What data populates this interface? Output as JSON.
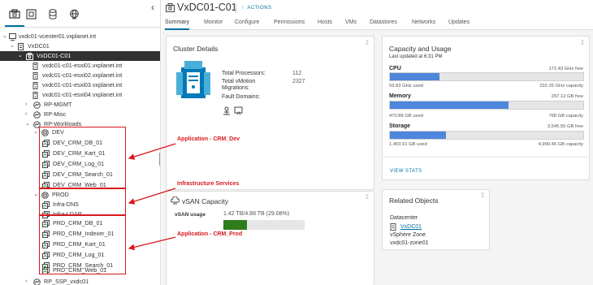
{
  "tree": {
    "collapse_glyph": "‹",
    "rows": [
      {
        "label": "vxdc01-vcenter01.vxplanet.int",
        "icon": "vcenter-icon",
        "caret": "⌄"
      },
      {
        "label": "VxDC01",
        "icon": "datacenter-icon",
        "caret": "⌄"
      },
      {
        "label": "VxDC01-C01",
        "icon": "cluster-icon",
        "caret": "⌄",
        "selected": true
      },
      {
        "label": "vxdc01-c01-esxi01.vxplanet.int",
        "icon": "host-icon"
      },
      {
        "label": "vxdc01-c01-esxi02.vxplanet.int",
        "icon": "host-icon"
      },
      {
        "label": "vxdc01-c01-esxi03.vxplanet.int",
        "icon": "host-icon"
      },
      {
        "label": "vxdc01-c01-esxi04.vxplanet.int",
        "icon": "host-icon"
      },
      {
        "label": "RP-MGMT",
        "icon": "resource-pool-icon",
        "caret": "›"
      },
      {
        "label": "RP-Misc",
        "icon": "resource-pool-icon",
        "caret": "›"
      },
      {
        "label": "RP-Workloads",
        "icon": "resource-pool-icon",
        "caret": "⌄"
      },
      {
        "label": "DEV",
        "icon": "vapp-icon",
        "caret": "⌄"
      },
      {
        "label": "DEV_CRM_DB_01",
        "icon": "vm-icon"
      },
      {
        "label": "DEV_CRM_Kart_01",
        "icon": "vm-icon"
      },
      {
        "label": "DEV_CRM_Log_01",
        "icon": "vm-icon"
      },
      {
        "label": "DEV_CRM_Search_01",
        "icon": "vm-icon"
      },
      {
        "label": "DEV_CRM_Web_01",
        "icon": "vm-icon"
      },
      {
        "label": "PROD",
        "icon": "vapp-icon",
        "caret": "⌄"
      },
      {
        "label": "Infra-DNS",
        "icon": "vm-icon"
      },
      {
        "label": "Infra-LDAP",
        "icon": "vm-icon"
      },
      {
        "label": "PRD_CRM_DB_01",
        "icon": "vm-icon"
      },
      {
        "label": "PRD_CRM_Indexer_01",
        "icon": "vm-icon"
      },
      {
        "label": "PRD_CRM_Kart_01",
        "icon": "vm-icon"
      },
      {
        "label": "PRD_CRM_Log_01",
        "icon": "vm-icon"
      },
      {
        "label": "PRD_CRM_Search_01",
        "icon": "vm-icon"
      },
      {
        "label": "PRD_CRM_Web_01",
        "icon": "vm-icon"
      },
      {
        "label": "RP_SSP_vxdc01",
        "icon": "resource-pool-icon",
        "caret": "›"
      }
    ]
  },
  "annotations": {
    "dev": "Application - CRM_Dev",
    "infra": "Infrastructure Services",
    "prod": "Application - CRM_Prod",
    "color": "#d9171b"
  },
  "header": {
    "title": "VxDC01-C01",
    "actions": "ACTIONS"
  },
  "tabs": [
    "Summary",
    "Monitor",
    "Configure",
    "Permissions",
    "Hosts",
    "VMs",
    "Datastores",
    "Networks",
    "Updates"
  ],
  "cluster_details": {
    "title": "Cluster Details",
    "total_processors_label": "Total Processors:",
    "total_processors": "112",
    "vmotion_label": "Total vMotion Migrations:",
    "vmotion": "2327",
    "fault_domains_label": "Fault Domains:"
  },
  "capacity": {
    "title": "Capacity and Usage",
    "updated": "Last updated at 6:31 PM",
    "cpu": {
      "name": "CPU",
      "free": "172.43 GHz free",
      "used": "59.83 GHz used",
      "capacity": "232.26 GHz capacity",
      "fraction": 0.258
    },
    "memory": {
      "name": "Memory",
      "free": "297.12 GB free",
      "used": "470.88 GB used",
      "capacity": "768 GB capacity",
      "fraction": 0.613
    },
    "storage": {
      "name": "Storage",
      "free": "3,545.55 GB free",
      "used": "1,453.91 GB used",
      "capacity": "4,999.46 GB capacity",
      "fraction": 0.291
    },
    "view_stats": "VIEW STATS",
    "accent": "#4e86dc"
  },
  "vsan": {
    "title": "vSAN Capacity",
    "usage_label": "vSAN usage",
    "usage_value": "1.42 TB/4.88 TB (29.08%)",
    "fraction": 0.2908,
    "bar_color": "#2e7d1c"
  },
  "related": {
    "title": "Related Objects",
    "datacenter_label": "Datacenter",
    "datacenter_link": "VxDC01",
    "zone_label": "vSphere Zone",
    "zone_value": "vxdc01-zone01"
  }
}
